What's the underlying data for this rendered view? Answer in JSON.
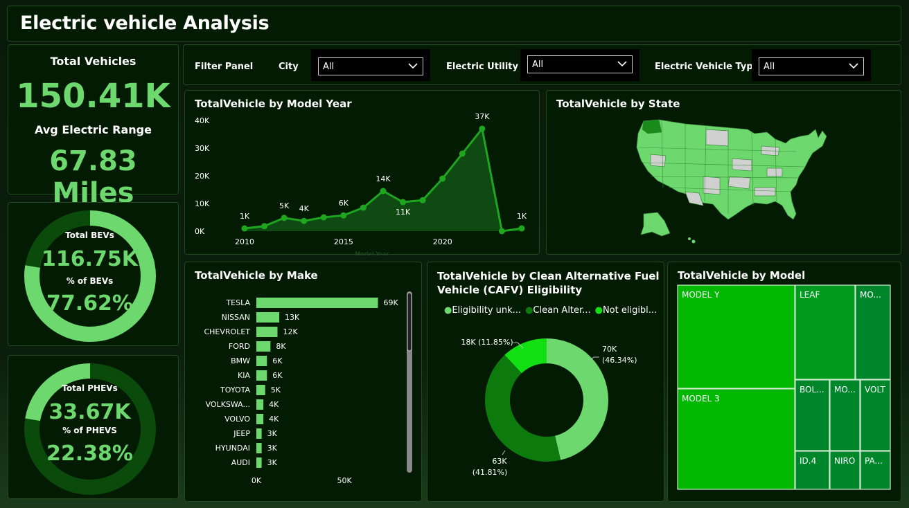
{
  "header": {
    "title": "Electric vehicle Analysis"
  },
  "kpi_total": {
    "total_label": "Total Vehicles",
    "total_value": "150.41K",
    "range_label": "Avg Electric Range",
    "range_value": "67.83 Miles"
  },
  "kpi_bev": {
    "label": "Total BEVs",
    "value": "116.75K",
    "pct_label": "% of BEVs",
    "pct_value": "77.62%",
    "pct_fraction": 0.7762
  },
  "kpi_phev": {
    "label": "Total PHEVs",
    "value": "33.67K",
    "pct_label": "% of PHEVS",
    "pct_value": "22.38%",
    "pct_fraction": 0.2238
  },
  "filters": {
    "panel_label": "Filter Panel",
    "city_label": "City",
    "city_value": "All",
    "utility_label": "Electric Utility",
    "utility_value": "All",
    "type_label": "Electric Vehicle Type",
    "type_value": "All"
  },
  "year_chart": {
    "title": "TotalVehicle by Model Year",
    "xlabel": "Model Year"
  },
  "state_map": {
    "title": "TotalVehicle by State"
  },
  "make_chart": {
    "title": "TotalVehicle by Make"
  },
  "cafv_chart": {
    "title_line1": "TotalVehicle by Clean Alternative Fuel",
    "title_line2": "Vehicle (CAFV) Eligibility",
    "legend": [
      {
        "label": "Eligibility unk...",
        "color": "#6dd86d"
      },
      {
        "label": "Clean Alter...",
        "color": "#0c7a0c"
      },
      {
        "label": "Not eligibl...",
        "color": "#12e012"
      }
    ]
  },
  "model_chart": {
    "title": "TotalVehicle by Model"
  },
  "colors": {
    "accent": "#6dd86d",
    "dark_green": "#0a4a0a",
    "bright_green": "#12e012",
    "panel_bg": "#031a03"
  },
  "chart_data": [
    {
      "type": "area",
      "title": "TotalVehicle by Model Year",
      "x": [
        2010,
        2011,
        2012,
        2013,
        2014,
        2015,
        2016,
        2017,
        2018,
        2019,
        2020,
        2021,
        2022,
        2023,
        2024
      ],
      "values": [
        1000,
        1800,
        4800,
        3700,
        5000,
        5700,
        8500,
        14500,
        10500,
        11200,
        19000,
        28000,
        37000,
        0,
        1000
      ],
      "labels": [
        "1K",
        "",
        "5K",
        "4K",
        "",
        "6K",
        "",
        "14K",
        "11K",
        "",
        "",
        "",
        "37K",
        "",
        "1K"
      ],
      "ylim": [
        0,
        40000
      ],
      "yticks": [
        "0K",
        "10K",
        "20K",
        "30K",
        "40K"
      ],
      "xticks": [
        "2010",
        "2015",
        "2020"
      ],
      "xlabel": "Model Year"
    },
    {
      "type": "bar",
      "title": "TotalVehicle by Make",
      "categories": [
        "TESLA",
        "NISSAN",
        "CHEVROLET",
        "FORD",
        "BMW",
        "KIA",
        "TOYOTA",
        "VOLKSWA...",
        "VOLVO",
        "JEEP",
        "HYUNDAI",
        "AUDI"
      ],
      "values": [
        69000,
        13000,
        12000,
        8000,
        6000,
        6000,
        5000,
        4000,
        4000,
        3000,
        3000,
        3000
      ],
      "labels": [
        "69K",
        "13K",
        "12K",
        "8K",
        "6K",
        "6K",
        "5K",
        "4K",
        "4K",
        "3K",
        "3K",
        "3K"
      ],
      "xticks": [
        "0K",
        "50K"
      ],
      "xlim": [
        0,
        70000
      ]
    },
    {
      "type": "pie",
      "title": "TotalVehicle by Clean Alternative Fuel Vehicle (CAFV) Eligibility",
      "categories": [
        "Eligibility unk...",
        "Clean Alter...",
        "Not eligibl..."
      ],
      "values": [
        70000,
        63000,
        18000
      ],
      "percents": [
        46.34,
        41.81,
        11.85
      ],
      "labels": [
        "70K\n(46.34%)",
        "63K\n(41.81%)",
        "18K (11.85%)"
      ]
    },
    {
      "type": "heatmap",
      "title": "TotalVehicle by Model",
      "categories": [
        "MODEL Y",
        "MODEL 3",
        "LEAF",
        "MO...",
        "BOL...",
        "MO...",
        "VOLT",
        "ID.4",
        "NIRO",
        "PA..."
      ]
    }
  ]
}
